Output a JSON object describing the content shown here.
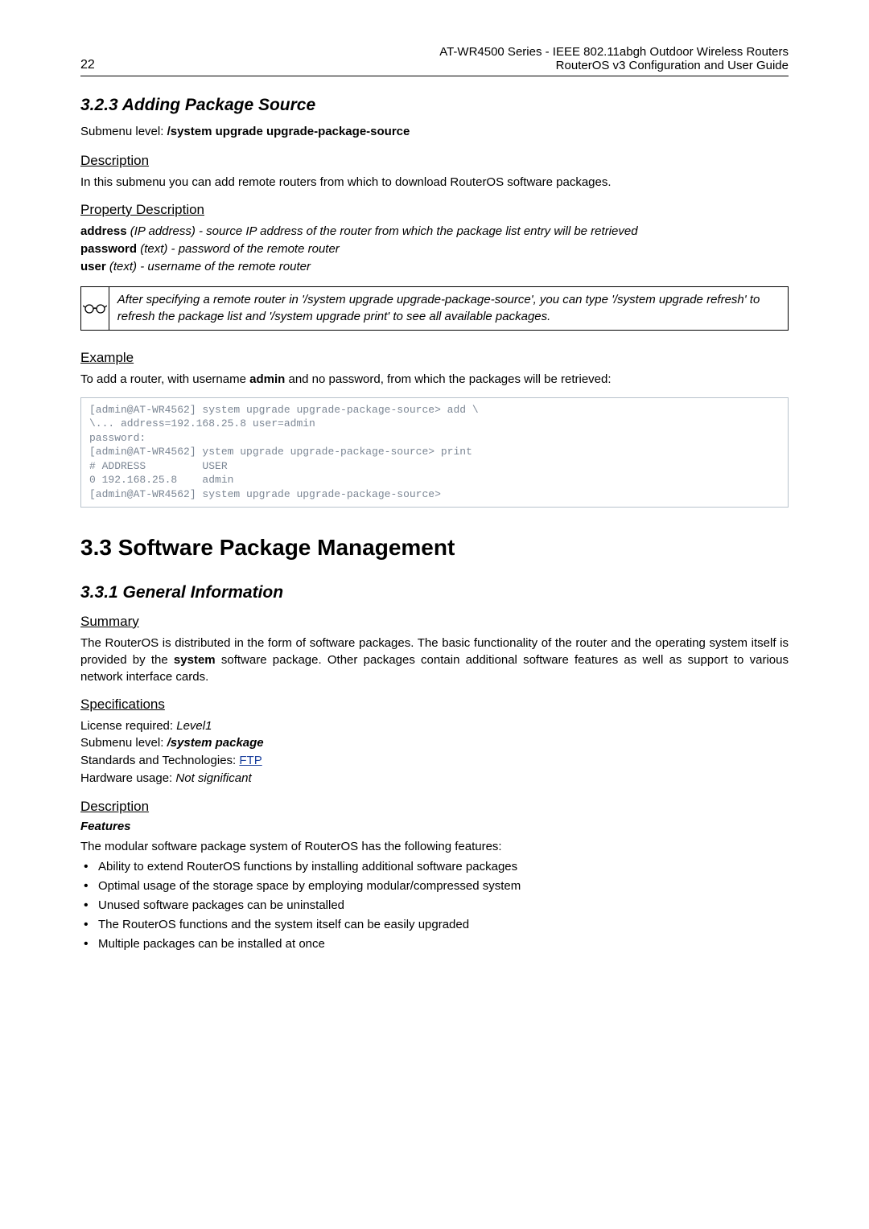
{
  "header": {
    "page_num": "22",
    "title_line1": "AT-WR4500 Series - IEEE 802.11abgh Outdoor Wireless Routers",
    "title_line2": "RouterOS v3 Configuration and User Guide"
  },
  "sec323": {
    "heading": "3.2.3 Adding Package Source",
    "submenu_label": "Submenu level: ",
    "submenu_value": "/system upgrade upgrade-package-source",
    "desc_hd": "Description",
    "desc_text": "In this submenu you can add remote routers from which to download RouterOS software packages.",
    "prop_hd": "Property Description",
    "prop_address_b": "address",
    "prop_address_p": " (IP address) - source IP address of the router from which the package list entry will be retrieved",
    "prop_password_b": "password",
    "prop_password_p": " (text) - password of the remote router",
    "prop_user_b": "user",
    "prop_user_p": " (text) - username of the remote router",
    "tip": "After specifying a remote router in '/system upgrade upgrade-package-source', you can type '/system upgrade refresh' to refresh the package list and '/system upgrade print' to see all available packages.",
    "ex_hd": "Example",
    "ex_text_pre": "To add a router, with username ",
    "ex_text_b": "admin",
    "ex_text_post": " and no password, from which the packages will be retrieved:",
    "code": "[admin@AT-WR4562] system upgrade upgrade-package-source> add \\\n\\... address=192.168.25.8 user=admin\npassword:\n[admin@AT-WR4562] ystem upgrade upgrade-package-source> print\n# ADDRESS         USER\n0 192.168.25.8    admin\n[admin@AT-WR4562] system upgrade upgrade-package-source>"
  },
  "sec33": {
    "heading": "3.3  Software Package Management"
  },
  "sec331": {
    "heading": "3.3.1 General Information",
    "sum_hd": "Summary",
    "sum_text_pre": "The RouterOS is distributed in the form of software packages. The basic functionality of the router and the operating system itself is provided by the ",
    "sum_text_b": "system",
    "sum_text_post": " software package. Other packages contain additional software features as well as support to various network interface cards.",
    "spec_hd": "Specifications",
    "spec_lic_l": "License required: ",
    "spec_lic_v": "Level1",
    "spec_sub_l": "Submenu level: ",
    "spec_sub_v": "/system package",
    "spec_std_l": "Standards and Technologies: ",
    "spec_std_v": "FTP",
    "spec_hw_l": "Hardware usage: ",
    "spec_hw_v": "Not significant",
    "desc_hd": "Description",
    "feat_hd": "Features",
    "feat_intro": "The modular software package system of RouterOS has the following features:",
    "features": [
      "Ability to extend RouterOS functions by installing additional software packages",
      "Optimal usage of the storage space by employing modular/compressed system",
      "Unused software packages can be uninstalled",
      "The RouterOS functions and the system itself can be easily upgraded",
      "Multiple packages can be installed at once"
    ]
  }
}
